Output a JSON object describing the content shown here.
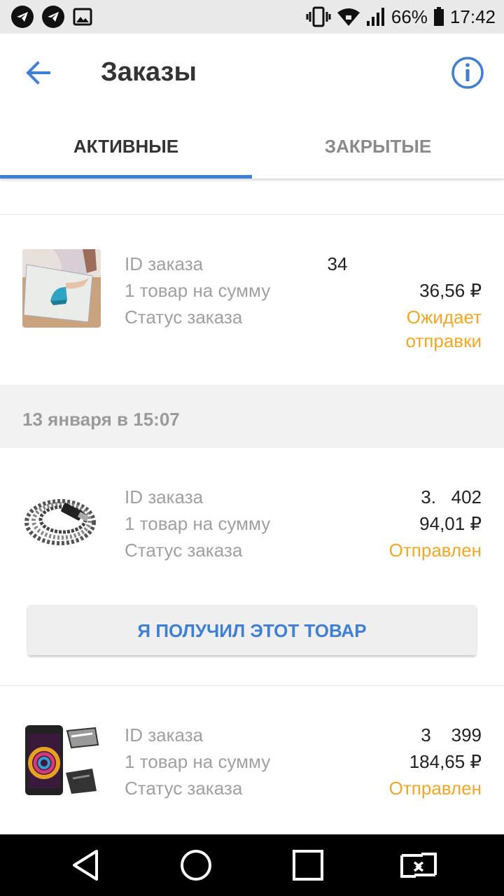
{
  "status_bar": {
    "battery": "66%",
    "time": "17:42",
    "icons": [
      "telegram-icon",
      "telegram-icon",
      "image-icon",
      "vibrate-icon",
      "wifi-icon",
      "signal-icon",
      "battery-icon"
    ]
  },
  "header": {
    "title": "Заказы",
    "back_icon": "arrow-back-icon",
    "info_icon": "info-icon",
    "accent": "#3f7fd6"
  },
  "tabs": {
    "active": "АКТИВНЫЕ",
    "inactive": "ЗАКРЫТЫЕ"
  },
  "orders": [
    {
      "id_label": "ID заказа",
      "id_value": "34",
      "sum_label": "1 товар на сумму",
      "sum_value": "36,56 ₽",
      "status_label": "Статус заказа",
      "status_line1": "Ожидает",
      "status_line2": "отправки"
    },
    {
      "date": "13 января в 15:07",
      "id_label": "ID заказа",
      "id_value": "3.   402",
      "sum_label": "1 товар на сумму",
      "sum_value": "94,01 ₽",
      "status_label": "Статус заказа",
      "status_value": "Отправлен",
      "action_label": "Я ПОЛУЧИЛ ЭТОТ ТОВАР"
    },
    {
      "id_label": "ID заказа",
      "id_value": "3    399",
      "sum_label": "1 товар на сумму",
      "sum_value": "184,65 ₽",
      "status_label": "Статус заказа",
      "status_value": "Отправлен"
    }
  ],
  "colors": {
    "status": "#f5a623",
    "accent": "#3f7fd6"
  },
  "nav": [
    "back-triangle-icon",
    "home-circle-icon",
    "recents-square-icon",
    "switch-app-icon"
  ]
}
